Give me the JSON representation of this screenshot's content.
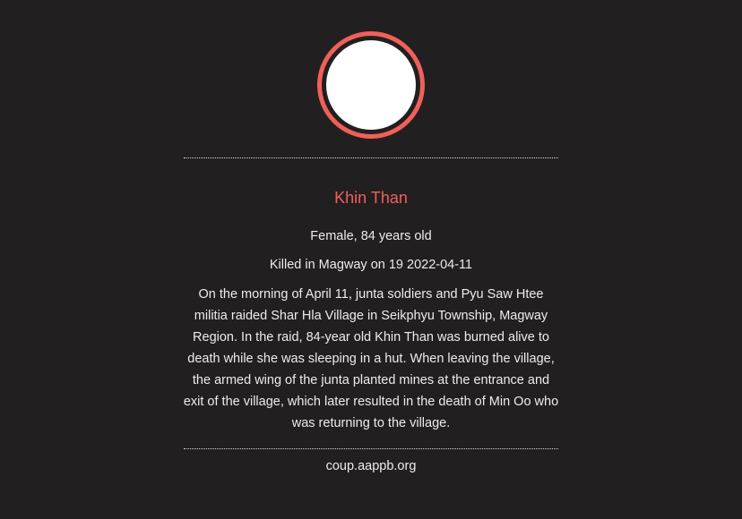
{
  "profile": {
    "name": "Khin Than",
    "gender_age": "Female, 84 years old",
    "killed": "Killed in Magway on 19 2022-04-11",
    "description_lines": [
      "On the morning of April 11, junta soldiers and Pyu Saw Htee",
      "militia raided Shar Hla Village in Seikphyu Township, Magway",
      "Region. In the raid, 84-year old Khin Than was burned alive to",
      "death while she was sleeping in a hut. When leaving the village,",
      "the armed wing of the junta planted mines at the entrance and",
      "exit of the village, which later resulted in the death of Min Oo who",
      "was returning to the village."
    ]
  },
  "footer": {
    "source": "coup.aappb.org"
  },
  "colors": {
    "accent": "#f0605a",
    "background": "#221f20"
  }
}
